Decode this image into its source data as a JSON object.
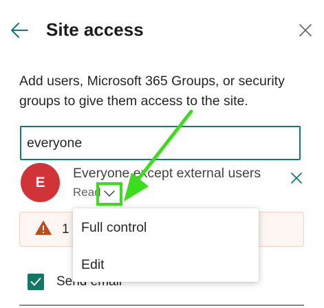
{
  "panel": {
    "title": "Site access",
    "description": "Add users, Microsoft 365 Groups, or security groups to give them access to the site."
  },
  "search": {
    "value": "everyone"
  },
  "result": {
    "avatar_letter": "E",
    "avatar_color": "#d13438",
    "name": "Everyone except external users",
    "role": "Read"
  },
  "warning": {
    "text": "1"
  },
  "checkbox": {
    "label": "Send email",
    "checked": true
  },
  "menu": {
    "items": [
      {
        "label": "Full control"
      },
      {
        "label": "Edit"
      }
    ]
  },
  "colors": {
    "accent": "#0f7a78",
    "annotation": "#3cdd1c",
    "warning_bg": "#fdf6f3",
    "warning_icon": "#c14a1c"
  },
  "icons": [
    "back-arrow-icon",
    "close-icon",
    "chevron-down-icon",
    "remove-icon",
    "warning-icon",
    "checkmark-icon"
  ]
}
